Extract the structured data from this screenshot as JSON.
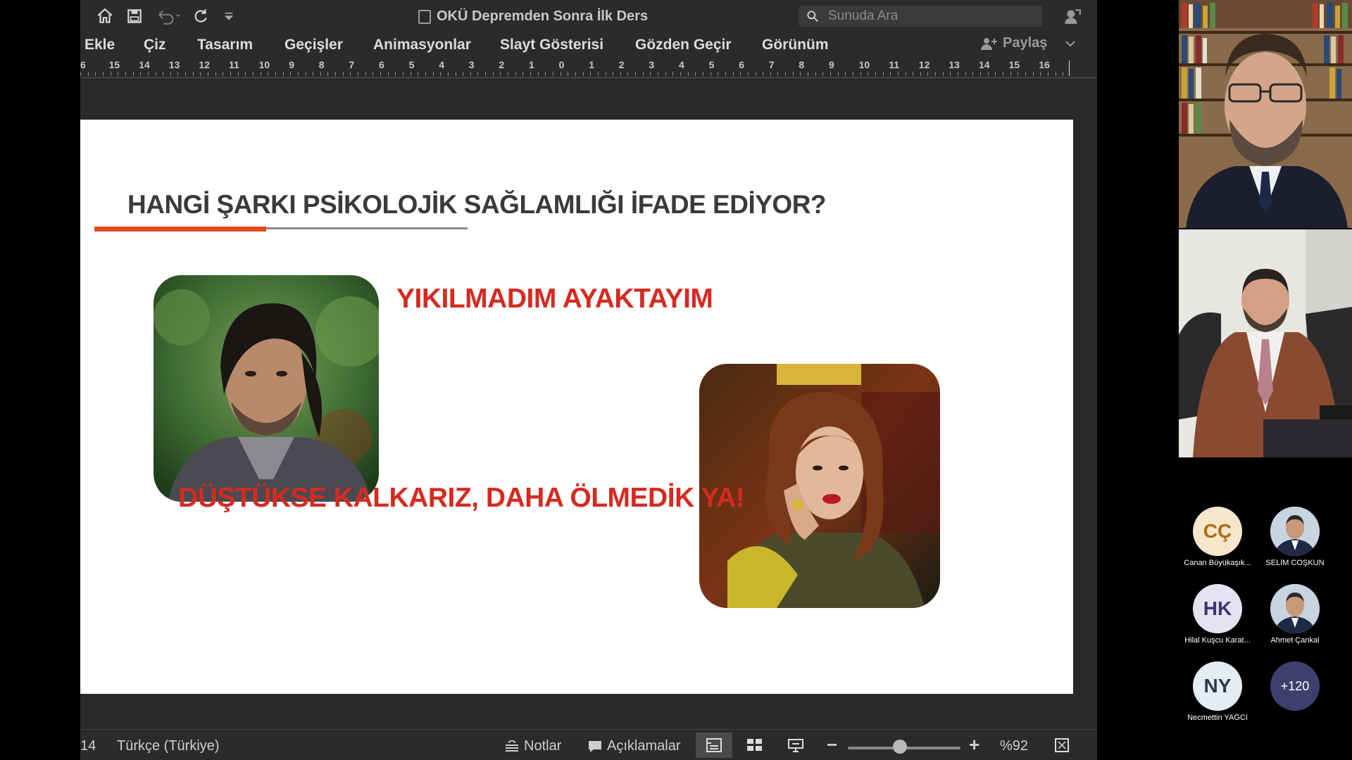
{
  "titlebar": {
    "doc_title": "OKÜ Depremden Sonra İlk Ders",
    "search_placeholder": "Sunuda Ara"
  },
  "menu": [
    "Ekle",
    "Çiz",
    "Tasarım",
    "Geçişler",
    "Animasyonlar",
    "Slayt Gösterisi",
    "Gözden Geçir",
    "Görünüm"
  ],
  "share_label": "Paylaş",
  "ruler_numbers": [
    "6",
    "15",
    "14",
    "13",
    "12",
    "11",
    "10",
    "9",
    "8",
    "7",
    "6",
    "5",
    "4",
    "3",
    "2",
    "1",
    "0",
    "1",
    "2",
    "3",
    "4",
    "5",
    "6",
    "7",
    "8",
    "9",
    "10",
    "11",
    "12",
    "13",
    "14",
    "15",
    "16"
  ],
  "slide": {
    "title": "HANGİ ŞARKI PSİKOLOJİK SAĞLAMLIĞI İFADE EDİYOR?",
    "song1": "YIKILMADIM AYAKTAYIM",
    "song2": "DÜŞTÜKSE KALKARIZ, DAHA ÖLMEDİK YA!"
  },
  "statusbar": {
    "slide_number": "14",
    "language": "Türkçe (Türkiye)",
    "notes_label": "Notlar",
    "comments_label": "Açıklamalar",
    "zoom": "%92",
    "zoom_fraction": 0.46
  },
  "participants": [
    {
      "initials": "CÇ",
      "name": "Canan Büyükaşık...",
      "bg": "#f5e6cc",
      "fg": "#b06a10"
    },
    {
      "initials": "",
      "name": "SELİM COŞKUN",
      "bg": "#d0d0d0",
      "fg": "#000"
    },
    {
      "initials": "HK",
      "name": "Hilal Kuşcu Karat...",
      "bg": "#e6e2f2",
      "fg": "#3b3670"
    },
    {
      "initials": "",
      "name": "Ahmet Çankal",
      "bg": "#d0d0d0",
      "fg": "#000"
    },
    {
      "initials": "NY",
      "name": "Necmettin YAĞCI",
      "bg": "#e4edf3",
      "fg": "#2b3a4a"
    },
    {
      "initials": "+120",
      "name": "",
      "bg": "#3f3f6e",
      "fg": "#ffffff"
    }
  ]
}
